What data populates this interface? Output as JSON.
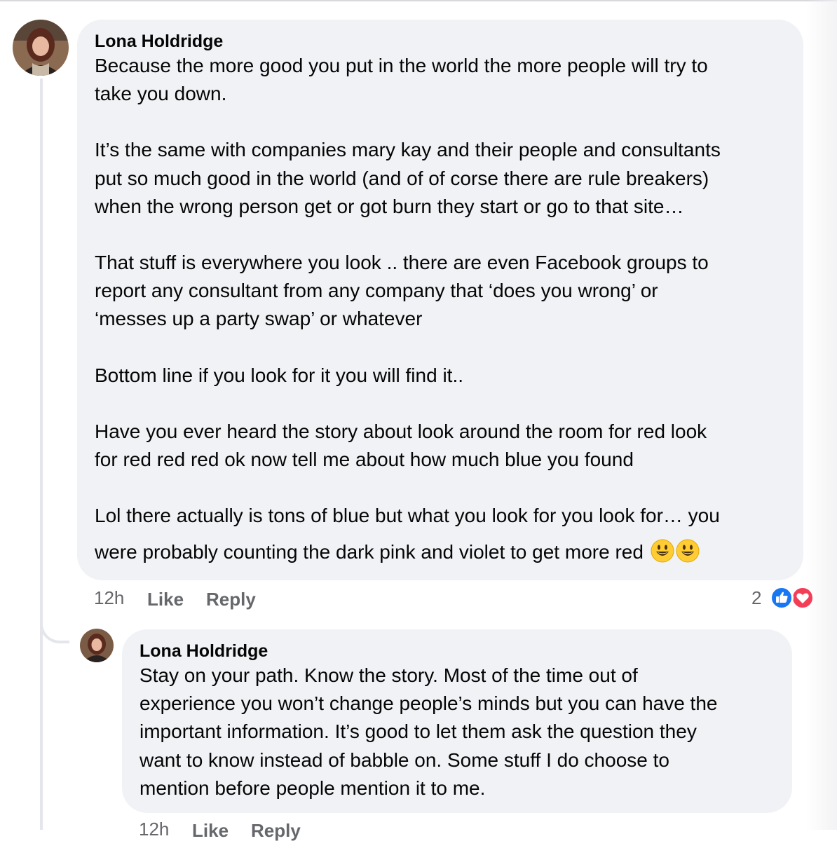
{
  "comments": [
    {
      "author": "Lona Holdridge",
      "paragraphs": [
        [
          "Because the more good you put in the world the more people will try to",
          "take you down."
        ],
        [
          "It’s the same with companies mary kay and their people and consultants",
          "put so much good in the world (and of of corse there are rule breakers)",
          "when the wrong person get or got burn they start or go to that site…"
        ],
        [
          "That stuff is everywhere you look .. there are even Facebook groups to",
          "report any consultant from any company that ‘does you wrong’ or",
          "‘messes up a party swap’ or whatever"
        ],
        [
          "Bottom line if you look for it you will find it.."
        ],
        [
          "Have you ever heard the story about look around the room for red look",
          "for red red red ok now tell me about how much blue you found"
        ],
        [
          "Lol there actually is tons of blue but  what you look for you look for… you",
          "were probably counting the dark pink and violet to get more red"
        ]
      ],
      "emoji": [
        "smiley-emoji",
        "smiley-emoji"
      ],
      "time": "12h",
      "like_label": "Like",
      "reply_label": "Reply",
      "reaction_count": "2",
      "reactions": [
        "like-reaction-icon",
        "love-reaction-icon"
      ]
    },
    {
      "author": "Lona Holdridge",
      "paragraphs": [
        [
          "Stay on your path. Know the story. Most of the time out of",
          "experience you won’t change people’s minds but you can have the",
          "important information. It’s good to let them ask the question they",
          "want to know instead of babble on. Some stuff I do choose to",
          "mention before people mention it to me."
        ]
      ],
      "time": "12h",
      "like_label": "Like",
      "reply_label": "Reply"
    }
  ],
  "colors": {
    "bubble": "#f0f2f5",
    "meta_text": "#65676b",
    "like_blue": "#1877f2",
    "love_red": "#f33e58",
    "thread_line": "#e4e6eb"
  }
}
